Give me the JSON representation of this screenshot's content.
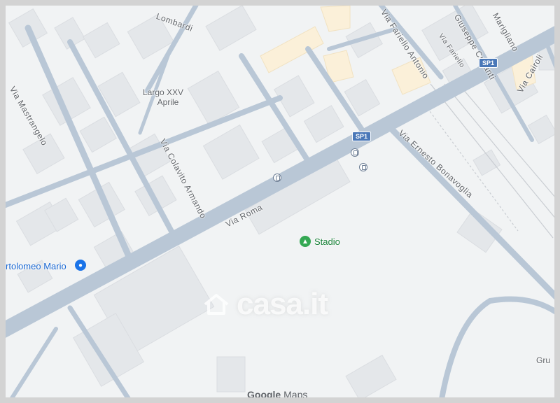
{
  "map": {
    "street_labels": {
      "via_roma": "Via Roma",
      "via_ernesto_bonavoglia": "Via Ernesto Bonavoglia",
      "via_colavito_armando": "Via Colavito Armando",
      "via_mastrangelo": "Via Mastrangelo",
      "via_fariello_antonio": "Via Fariello Antonio",
      "via_fariello": "Via Fariello",
      "via_cairoli": "Via Cairoli",
      "via_lombardi": "Lombardi",
      "via_marigliano": "Marigliano",
      "via_crisanti": "Giuseppe Crisanti"
    },
    "place_labels": {
      "largo_line1": "Largo XXV",
      "largo_line2": "Aprile",
      "stadio": "Stadio",
      "bartolomeo": "rtolomeo Mario",
      "gru": "Gru"
    },
    "route_shields": [
      "SP1",
      "SP1"
    ],
    "poi_icons": {
      "stadio": "park-icon",
      "bartolomeo": "shopping-bag-icon",
      "bus": "bus-stop-icon"
    },
    "watermark": "casa.it",
    "brand": {
      "google": "Google",
      "maps": "Maps"
    },
    "colors": {
      "road": "#b9c7d6",
      "background": "#f1f3f4",
      "building": "#e4e7ea",
      "highlight_building": "#fbf0d9",
      "poi_green": "#34a853",
      "poi_blue": "#1a73e8",
      "shield": "#4a78b8"
    }
  }
}
